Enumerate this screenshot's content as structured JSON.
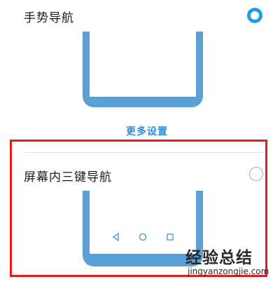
{
  "gesture_option": {
    "label": "手势导航",
    "selected": true
  },
  "more_settings": "更多设置",
  "three_key_option": {
    "label": "屏幕内三键导航",
    "selected": false
  },
  "nav_icons": [
    "back-triangle-icon",
    "home-circle-icon",
    "recents-square-icon"
  ],
  "watermark": {
    "site_cn": "经验总结",
    "url": "jingyanzongjie.com"
  },
  "colors": {
    "accent": "#1f9de6",
    "phone": "#5b9fd7",
    "highlight": "#e21b1b"
  }
}
